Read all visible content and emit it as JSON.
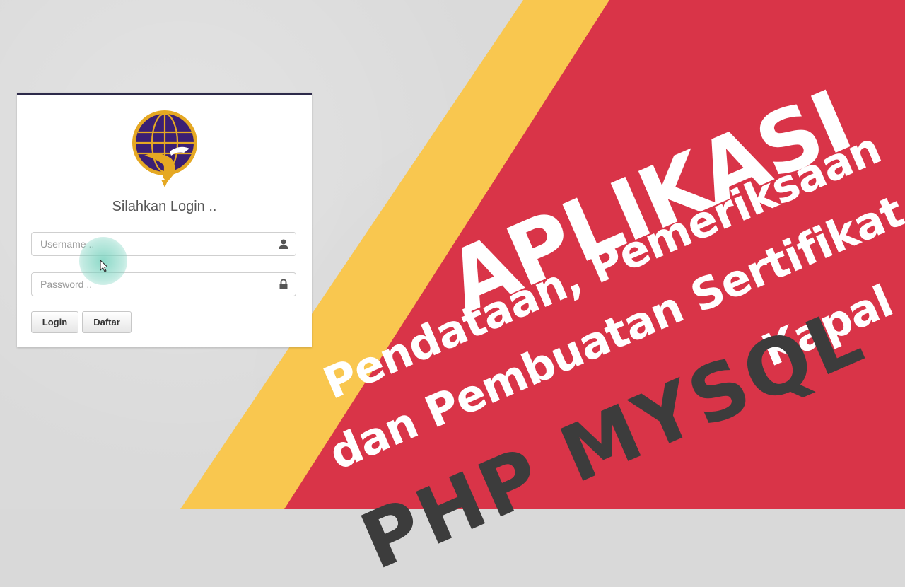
{
  "login": {
    "title": "Silahkan Login ..",
    "username_placeholder": "Username ..",
    "password_placeholder": "Password ..",
    "login_label": "Login",
    "daftar_label": "Daftar"
  },
  "headline": {
    "title": "APLIKASI",
    "subtitle_line1": "Pendataan, Pemeriksaan",
    "subtitle_line2": "dan Pembuatan Sertifikat",
    "subtitle_line3": "Kapal",
    "tech": "PHP MYSQL"
  },
  "colors": {
    "background": "#dadada",
    "yellow_stripe": "#f9c74f",
    "red_panel": "#d93448",
    "logo_purple": "#3b1f73",
    "logo_gold": "#e5a823",
    "tech_text": "#3c3c3c"
  },
  "icons": {
    "username": "user-icon",
    "password": "lock-icon",
    "cursor": "mouse-cursor-icon"
  }
}
